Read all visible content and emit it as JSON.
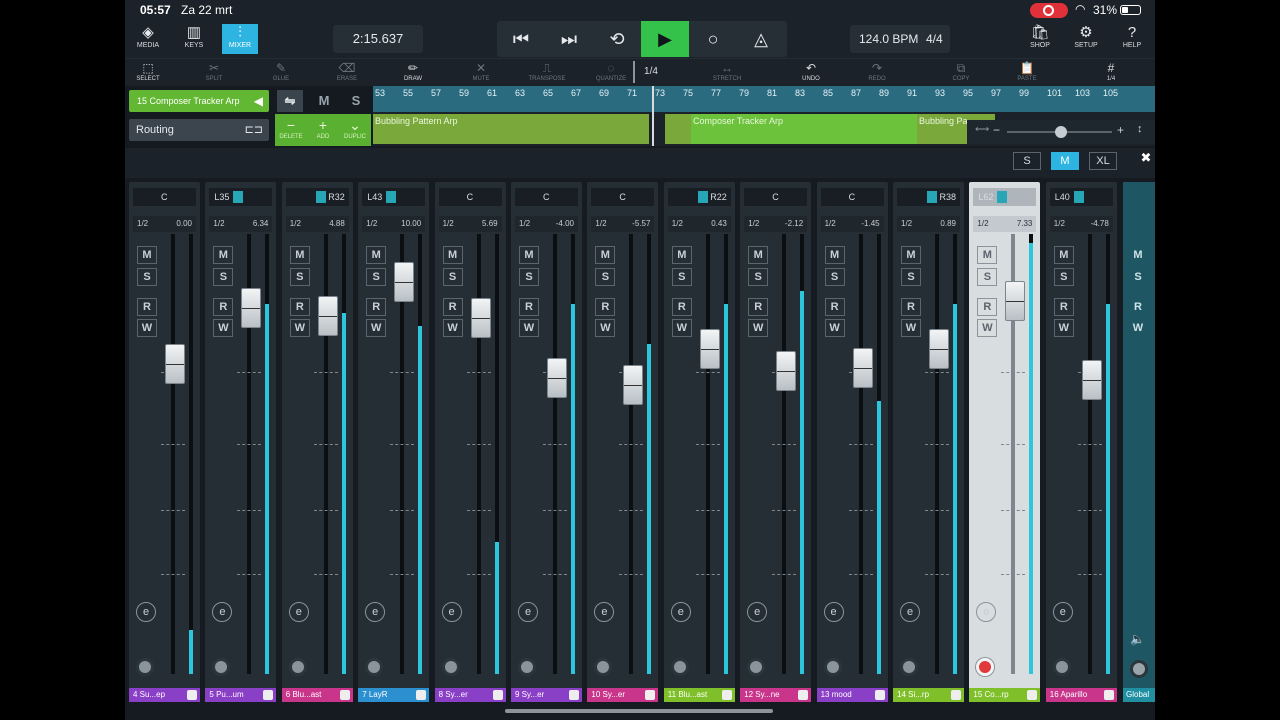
{
  "status": {
    "time": "05:57",
    "date": "Za 22 mrt",
    "battery": "31%"
  },
  "toolbar": {
    "left": [
      {
        "label": "MEDIA",
        "icon": "media-icon",
        "glyph": "◈"
      },
      {
        "label": "KEYS",
        "icon": "keys-icon",
        "glyph": "▥"
      },
      {
        "label": "MIXER",
        "icon": "mixer-icon",
        "glyph": "⫶"
      }
    ],
    "timecode": "2:15.637",
    "tempo": "124.0 BPM",
    "signature": "4/4",
    "right": [
      {
        "label": "SHOP",
        "icon": "shop-icon",
        "glyph": "🛍"
      },
      {
        "label": "SETUP",
        "icon": "gear-icon",
        "glyph": "⚙"
      },
      {
        "label": "HELP",
        "icon": "help-icon",
        "glyph": "?"
      }
    ]
  },
  "tools": [
    {
      "label": "SELECT",
      "glyph": "⬚",
      "on": true
    },
    {
      "label": "SPLIT",
      "glyph": "✂",
      "on": false
    },
    {
      "label": "GLUE",
      "glyph": "✎",
      "on": false
    },
    {
      "label": "ERASE",
      "glyph": "⌫",
      "on": false
    },
    {
      "label": "DRAW",
      "glyph": "✏",
      "on": true
    },
    {
      "label": "MUTE",
      "glyph": "✕",
      "on": false
    },
    {
      "label": "TRANSPOSE",
      "glyph": "⎍",
      "on": false
    },
    {
      "label": "QUANTIZE",
      "glyph": "◌",
      "on": false
    },
    {
      "label": "STRETCH",
      "glyph": "↔",
      "on": false
    },
    {
      "label": "UNDO",
      "glyph": "↶",
      "on": true
    },
    {
      "label": "REDO",
      "glyph": "↷",
      "on": false
    },
    {
      "label": "COPY",
      "glyph": "⧉",
      "on": false
    },
    {
      "label": "PASTE",
      "glyph": "📋",
      "on": false
    },
    {
      "label": "1/4",
      "glyph": "#",
      "on": true
    }
  ],
  "quantize_value": "1/4",
  "arrange": {
    "selected_track": "15  Composer Tracker Arp",
    "routing": "Routing",
    "mute": "M",
    "solo": "S",
    "edit_buttons": [
      "DELETE",
      "ADD",
      "DUPLIC"
    ],
    "ruler": [
      "53",
      "55",
      "57",
      "59",
      "61",
      "63",
      "65",
      "67",
      "69",
      "71",
      "73",
      "75",
      "77",
      "79",
      "81",
      "83",
      "85",
      "87",
      "89",
      "91",
      "93",
      "95",
      "97",
      "99",
      "101",
      "103",
      "105"
    ],
    "clips": [
      "Bubbling Pattern Arp",
      "Composer Tracker Arp",
      "Bubbling Pa"
    ]
  },
  "sizes": [
    "S",
    "M",
    "XL"
  ],
  "channels": [
    {
      "num": "4",
      "name": "4   Su...ep",
      "pan": "C",
      "send": "0.00",
      "color": "#8a3fc7",
      "fader": 0.66,
      "meter": 0.1
    },
    {
      "num": "5",
      "name": "5   Pu...um",
      "pan": "L35",
      "send": "6.34",
      "color": "#8a3fc7",
      "fader": 0.89,
      "meter": 0.84
    },
    {
      "num": "6",
      "name": "6   Blu...ast",
      "pan": "R32",
      "send": "4.88",
      "color": "#c8358a",
      "fader": 0.86,
      "meter": 0.82
    },
    {
      "num": "7",
      "name": "7   LayR",
      "pan": "L43",
      "send": "10.00",
      "color": "#2c8fd0",
      "fader": 1.0,
      "meter": 0.79
    },
    {
      "num": "8",
      "name": "8   Sy...er",
      "pan": "C",
      "send": "5.69",
      "color": "#8a3fc7",
      "fader": 0.85,
      "meter": 0.3
    },
    {
      "num": "9",
      "name": "9   Sy...er",
      "pan": "C",
      "send": "-4.00",
      "color": "#8a3fc7",
      "fader": 0.6,
      "meter": 0.84
    },
    {
      "num": "10",
      "name": "10  Sy...er",
      "pan": "C",
      "send": "-5.57",
      "color": "#c8358a",
      "fader": 0.57,
      "meter": 0.75
    },
    {
      "num": "11",
      "name": "11  Blu...ast",
      "pan": "R22",
      "send": "0.43",
      "color": "#7fbf2a",
      "fader": 0.72,
      "meter": 0.84
    },
    {
      "num": "12",
      "name": "12  Sy...ne",
      "pan": "C",
      "send": "-2.12",
      "color": "#c8358a",
      "fader": 0.63,
      "meter": 0.87
    },
    {
      "num": "13",
      "name": "13  mood",
      "pan": "C",
      "send": "-1.45",
      "color": "#8a3fc7",
      "fader": 0.64,
      "meter": 0.62
    },
    {
      "num": "14",
      "name": "14  Si...rp",
      "pan": "R38",
      "send": "0.89",
      "color": "#7fbf2a",
      "fader": 0.72,
      "meter": 0.84
    },
    {
      "num": "15",
      "name": "15  Co...rp",
      "pan": "L62",
      "send": "7.33",
      "color": "#7fbf2a",
      "fader": 0.92,
      "meter": 0.98,
      "selected": true
    },
    {
      "num": "16",
      "name": "16  Aparillo",
      "pan": "L40",
      "send": "-4.78",
      "color": "#c8358a",
      "fader": 0.59,
      "meter": 0.84
    }
  ],
  "global": {
    "name": "Global",
    "m": "M",
    "s": "S",
    "r": "R",
    "w": "W"
  },
  "labels": {
    "m": "M",
    "s": "S",
    "r": "R",
    "w": "W",
    "send_prefix": "1/2",
    "edit": "e"
  }
}
